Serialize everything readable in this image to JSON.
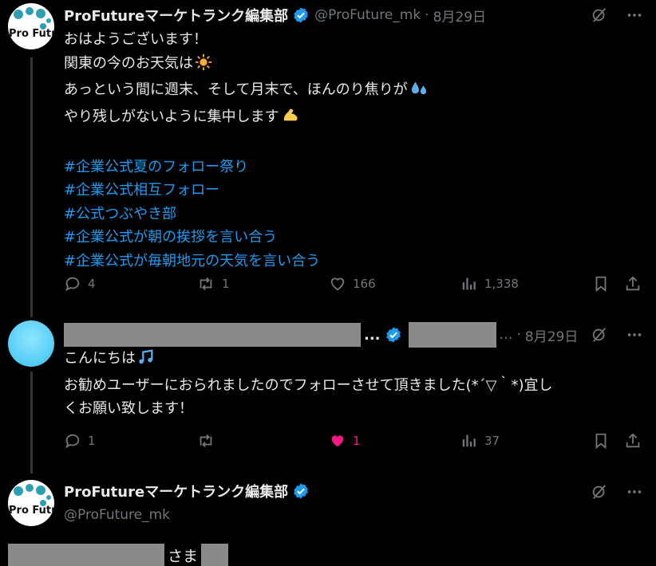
{
  "post1": {
    "author_name": "ProFutureマーケトランク編集部",
    "handle": "@ProFuture_mk",
    "separator": "·",
    "date": "8月29日",
    "lines": [
      "おはようございます！",
      "関東の今のお天気は",
      "あっという間に週末、そして月末で、ほんのり焦りが",
      "やり残しがないように集中します"
    ],
    "hashtags": [
      "#企業公式夏のフォロー祭り",
      "#企業公式相互フォロー",
      "#公式つぶやき部",
      "#企業公式が朝の挨拶を言い合う",
      "#企業公式が毎朝地元の天気を言い合う"
    ],
    "reply_count": "4",
    "repost_count": "1",
    "like_count": "166",
    "view_count": "1,338"
  },
  "post2": {
    "name_ellipsis": "...",
    "handle_ellipsis": "…",
    "separator": "·",
    "date": "8月29日",
    "lines": [
      "こんにちは",
      "お勧めユーザーにおられましたのでフォローさせて頂きました(*´▽｀*)宜し",
      "くお願い致します！"
    ],
    "reply_count": "1",
    "repost_count": "",
    "like_count": "1",
    "view_count": "37"
  },
  "post3": {
    "author_name": "ProFutureマーケトランク編集部",
    "handle": "@ProFuture_mk",
    "text_fragment": "さま"
  },
  "avatar_logo_text": "Pro Futur",
  "icons": {
    "grok": "grok-icon",
    "more": "more-icon",
    "reply": "reply-icon",
    "repost": "repost-icon",
    "like": "heart-icon",
    "views": "views-icon",
    "bookmark": "bookmark-icon",
    "share": "share-icon",
    "verified": "verified-badge-icon",
    "sun": "sun-emoji-icon",
    "sweat": "sweat-droplets-emoji-icon",
    "muscle": "flexed-biceps-emoji-icon",
    "music": "musical-notes-emoji-icon"
  },
  "colors": {
    "background": "#000000",
    "text": "#e7e9ea",
    "muted": "#71767b",
    "link": "#1d9bf0",
    "like": "#f91880",
    "verified": "#1d9bf0"
  }
}
